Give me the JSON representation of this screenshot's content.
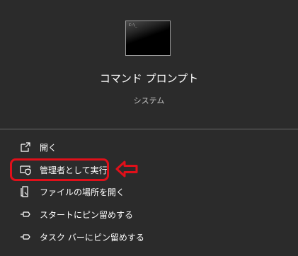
{
  "header": {
    "app_name": "コマンド プロンプト",
    "app_type": "システム",
    "app_icon": "command-prompt-icon"
  },
  "menu": {
    "items": [
      {
        "label": "開く",
        "icon": "open-icon"
      },
      {
        "label": "管理者として実行",
        "icon": "run-as-admin-shield-icon"
      },
      {
        "label": "ファイルの場所を開く",
        "icon": "file-location-icon"
      },
      {
        "label": "スタートにピン留めする",
        "icon": "pin-icon"
      },
      {
        "label": "タスク バーにピン留めする",
        "icon": "pin-icon"
      }
    ]
  },
  "annotation": {
    "highlight_color": "#e0101a"
  },
  "colors": {
    "background": "#2b2b2b",
    "text": "#ffffff",
    "subtext": "#c8c8c8",
    "divider": "#6a6a6a"
  }
}
